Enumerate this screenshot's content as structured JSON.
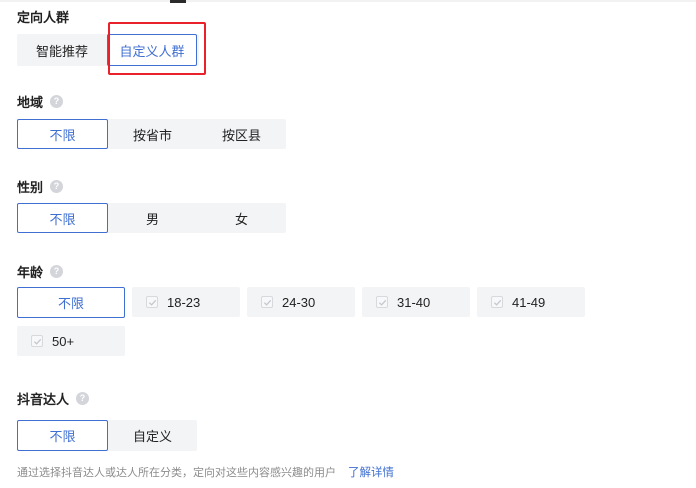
{
  "audience": {
    "title": "定向人群",
    "options": [
      "智能推荐",
      "自定义人群"
    ],
    "selected": "自定义人群"
  },
  "region": {
    "title": "地域",
    "help_icon": "question-circle-icon",
    "options": [
      "不限",
      "按省市",
      "按区县"
    ],
    "selected": "不限"
  },
  "gender": {
    "title": "性别",
    "help_icon": "question-circle-icon",
    "options": [
      "不限",
      "男",
      "女"
    ],
    "selected": "不限"
  },
  "age": {
    "title": "年龄",
    "help_icon": "question-circle-icon",
    "unlimited": "不限",
    "options": [
      "18-23",
      "24-30",
      "31-40",
      "41-49",
      "50+"
    ],
    "checkbox_icon": "check-icon"
  },
  "douyin_creator": {
    "title": "抖音达人",
    "help_icon": "question-circle-icon",
    "options": [
      "不限",
      "自定义"
    ],
    "selected": "不限",
    "hint": "通过选择抖音达人或达人所在分类，定向对这些内容感兴趣的用户",
    "link": "了解详情"
  },
  "colors": {
    "accent": "#3f6fd1",
    "highlight_box": "#e8212a",
    "segment_bg": "#f3f4f6"
  }
}
